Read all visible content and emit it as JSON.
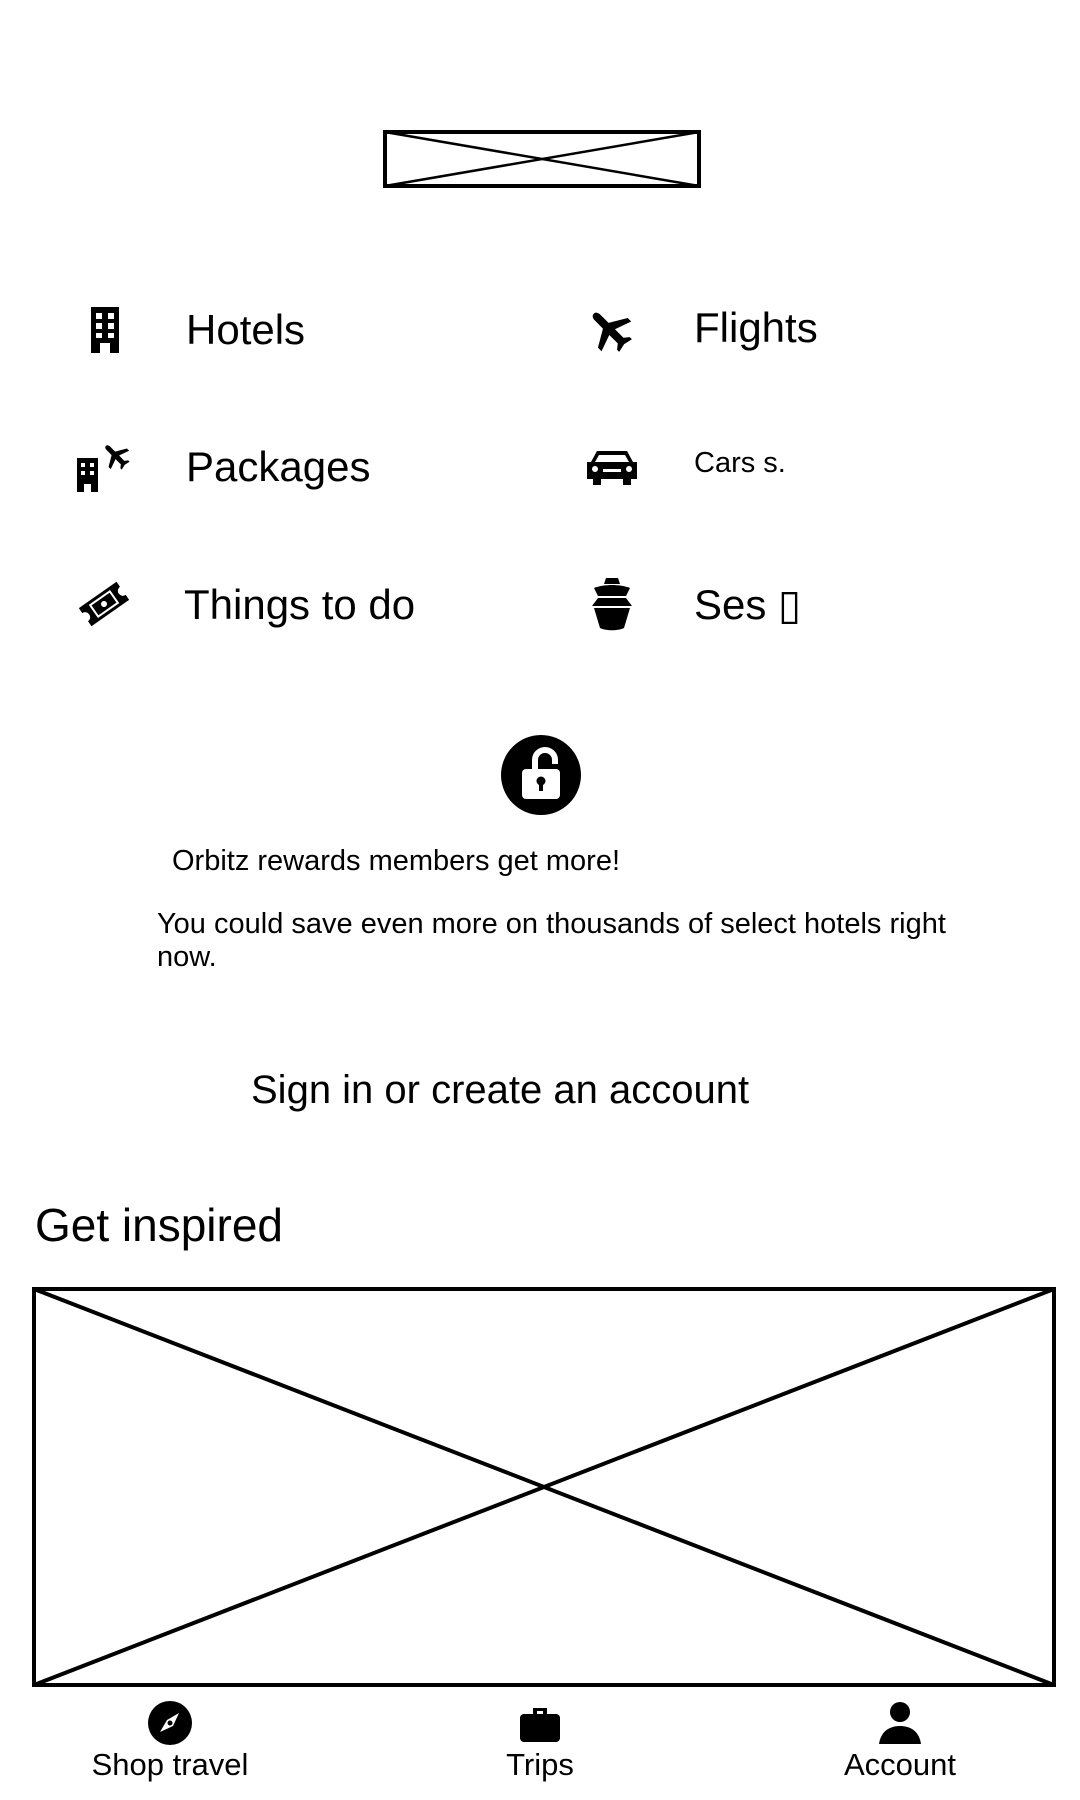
{
  "logo": {
    "icon": "image-placeholder-icon"
  },
  "categories": [
    {
      "label": "Hotels",
      "icon": "hotel-icon"
    },
    {
      "label": "Flights",
      "icon": "plane-icon"
    },
    {
      "label": "Packages",
      "icon": "package-icon"
    },
    {
      "label": "Cars s.",
      "icon": "car-icon"
    },
    {
      "label": "Things to do",
      "icon": "ticket-icon"
    },
    {
      "label": "Ses ▯",
      "icon": "cruise-ship-icon"
    }
  ],
  "rewards": {
    "icon": "unlock-icon",
    "title": "Orbitz rewards members get more!",
    "description": "You could save even more on thousands of select hotels right now.",
    "cta": "Sign in or create an account"
  },
  "inspired": {
    "title": "Get inspired",
    "image": "image-placeholder-icon"
  },
  "bottom_nav": [
    {
      "label": "Shop travel",
      "icon": "compass-icon"
    },
    {
      "label": "Trips",
      "icon": "briefcase-icon"
    },
    {
      "label": "Account",
      "icon": "person-icon"
    }
  ]
}
